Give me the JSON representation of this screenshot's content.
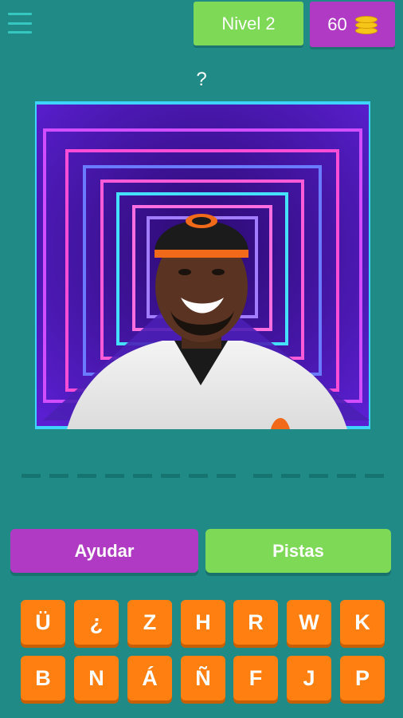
{
  "header": {
    "menu_icon": "hamburger-menu-icon",
    "level_label": "Nivel 2",
    "coins": "60",
    "coin_icon": "coin-stack-icon"
  },
  "question": {
    "prompt": "?"
  },
  "answer": {
    "word_lengths": [
      8,
      5
    ]
  },
  "actions": {
    "help_label": "Ayudar",
    "hints_label": "Pistas"
  },
  "keyboard": {
    "rows": [
      [
        "Ü",
        "¿",
        "Z",
        "H",
        "R",
        "W",
        "K"
      ],
      [
        "B",
        "N",
        "Á",
        "Ñ",
        "F",
        "J",
        "P"
      ]
    ]
  },
  "colors": {
    "background": "#1f8a86",
    "purple": "#b03ac4",
    "green": "#7ed957",
    "orange": "#ff7f11",
    "slot": "#157370"
  }
}
